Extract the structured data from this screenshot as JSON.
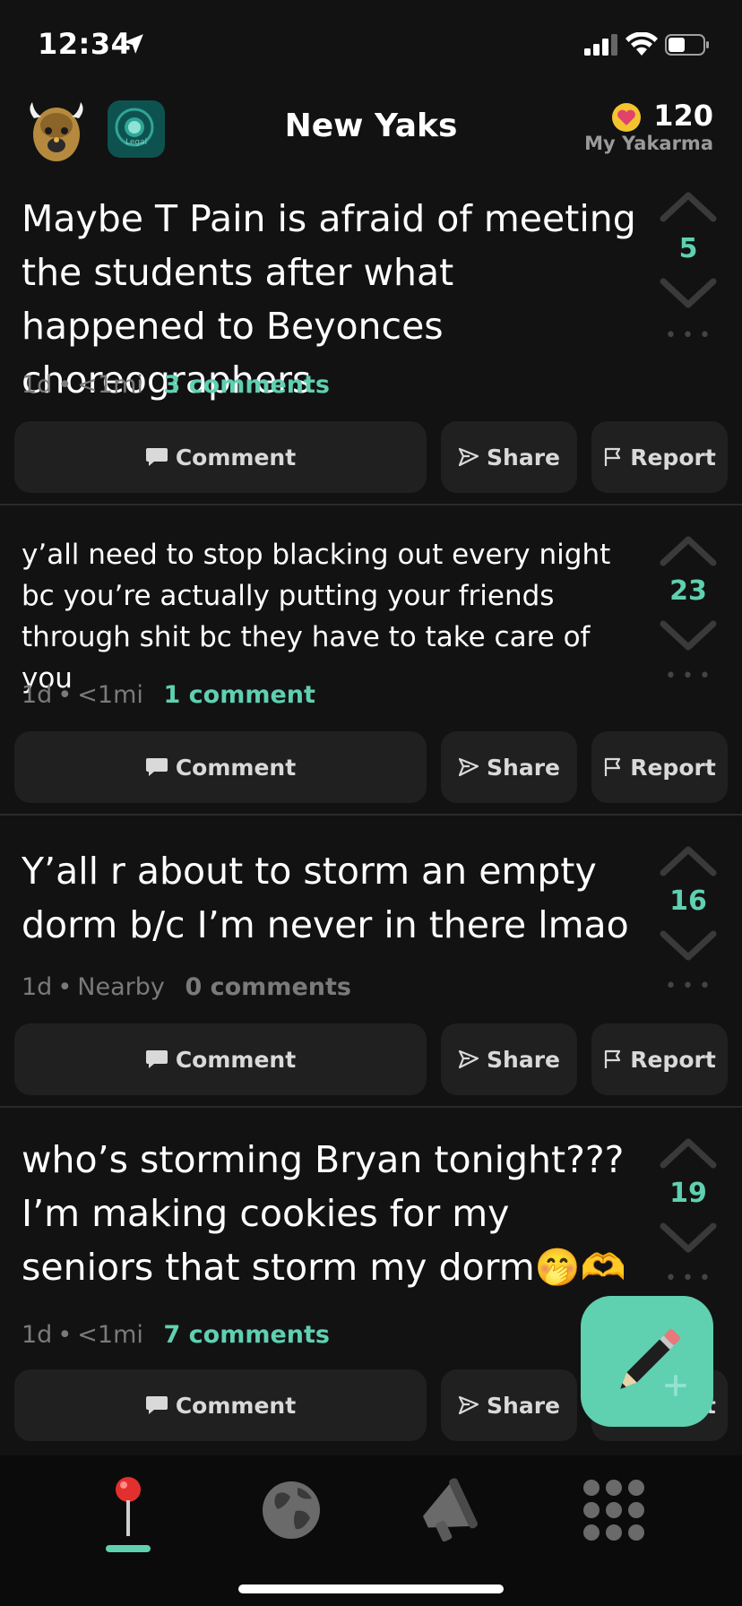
{
  "status_bar": {
    "time": "12:34"
  },
  "header": {
    "title": "New Yaks",
    "channel_badge_text": "Legal",
    "karma_count": "120",
    "karma_label": "My Yakarma"
  },
  "posts": [
    {
      "text": "Maybe T Pain is afraid of meeting the students after what happened to Beyonces choreographers",
      "age": "1d",
      "distance": "<1mi",
      "comments": "3 comments",
      "votes": "5"
    },
    {
      "text": "y’all need to stop blacking out every night bc you’re actually putting your friends through shit bc they have to take care of you",
      "age": "1d",
      "distance": "<1mi",
      "comments": "1 comment",
      "votes": "23"
    },
    {
      "text": "Y’all r about to storm an empty dorm b/c I’m never in there lmao",
      "age": "1d",
      "distance": "Nearby",
      "comments": "0 comments",
      "votes": "16"
    },
    {
      "text": "who’s storming Bryan tonight??? I’m making cookies for my seniors that storm my dorm🤭🫶",
      "age": "1d",
      "distance": "<1mi",
      "comments": "7 comments",
      "votes": "19"
    }
  ],
  "actions": {
    "comment_label": "Comment",
    "share_label": "Share",
    "report_label": "Report"
  },
  "colors": {
    "accent": "#5fd0b0",
    "background": "#121212",
    "button": "#202020"
  },
  "tab_bar": {
    "tabs": [
      "map-pin-icon",
      "globe-icon",
      "megaphone-icon",
      "grid-icon"
    ],
    "active": 0
  }
}
